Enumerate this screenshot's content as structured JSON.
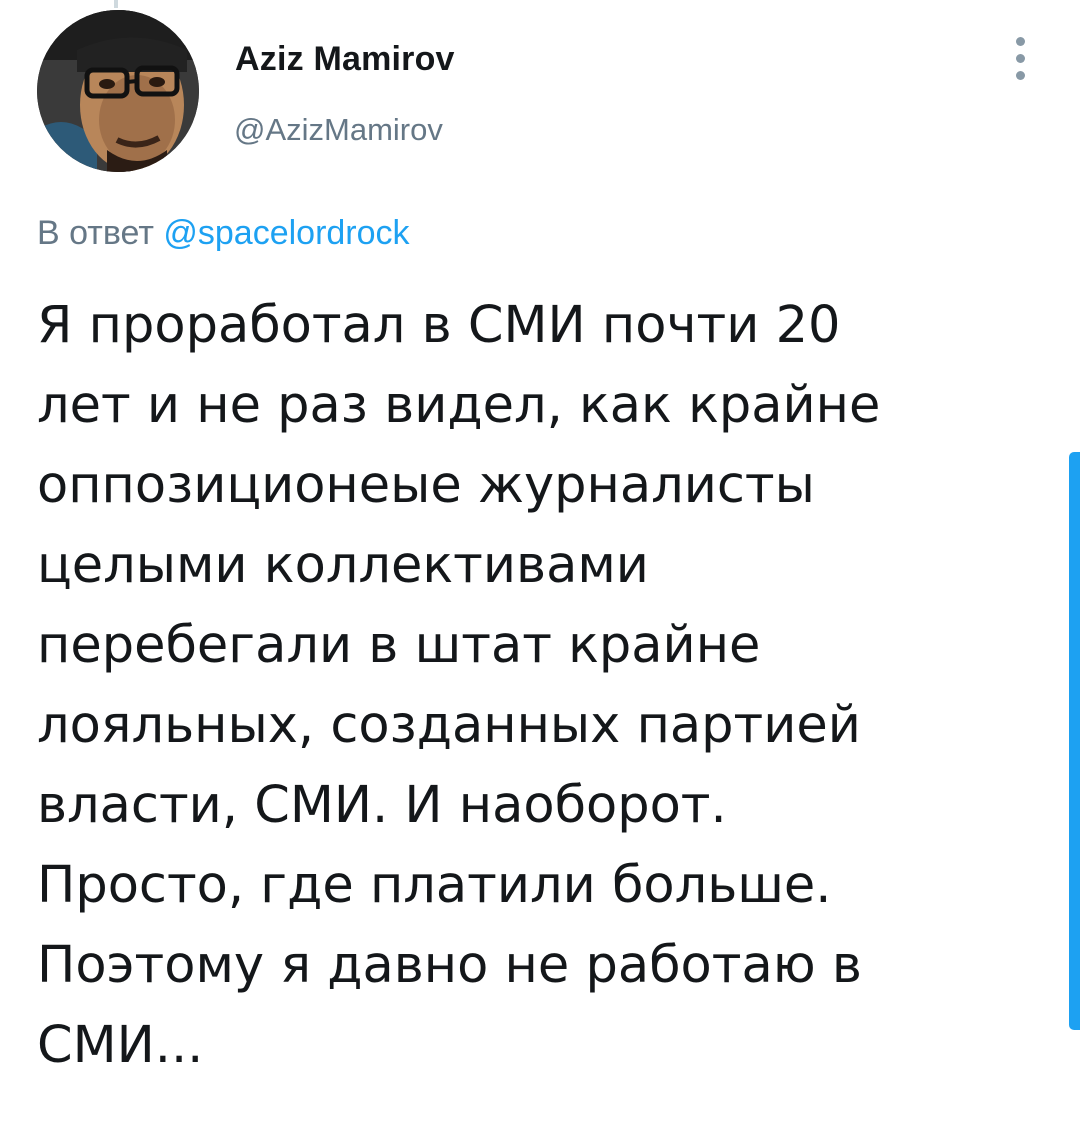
{
  "author": {
    "display_name": "Aziz Mamirov",
    "handle": "@AzizMamirov"
  },
  "reply": {
    "prefix": "В ответ",
    "mention": "@spacelordrock"
  },
  "tweet": {
    "lines": [
      "Я проработал в СМИ почти 20",
      "лет и не раз видел, как крайне",
      "оппозиционеые журналисты",
      "целыми коллективами",
      "перебегали в штат крайне",
      "лояльных, созданных партией",
      "власти, СМИ. И наоборот.",
      "Просто, где платили больше.",
      "Поэтому я давно не работаю в",
      "СМИ..."
    ]
  },
  "icons": {
    "more": "vertical-dots-icon"
  },
  "colors": {
    "text": "#14171a",
    "secondary": "#657786",
    "link": "#1da1f2",
    "scrollbar": "#1da1f2"
  }
}
